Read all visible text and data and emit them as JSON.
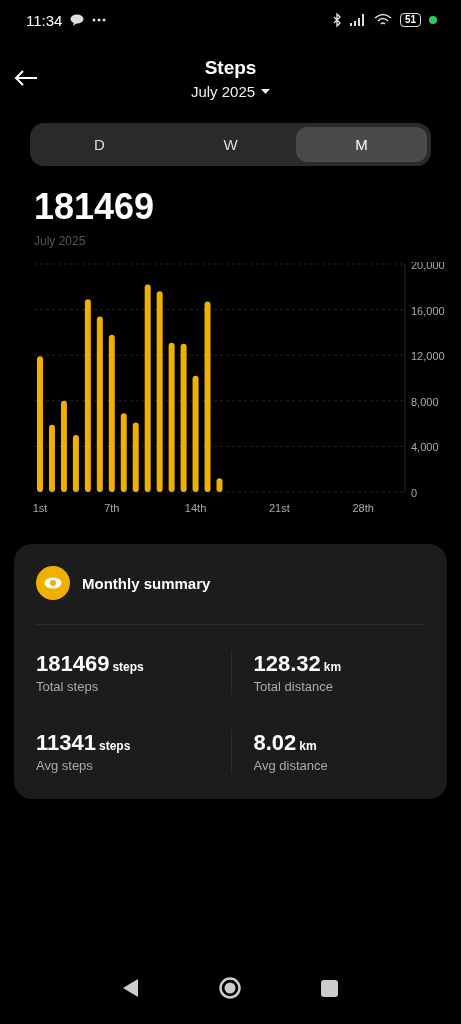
{
  "status_bar": {
    "time": "11:34",
    "battery": "51"
  },
  "header": {
    "title": "Steps",
    "period": "July 2025"
  },
  "tabs": [
    {
      "label": "D",
      "selected": false
    },
    {
      "label": "W",
      "selected": false
    },
    {
      "label": "M",
      "selected": true
    }
  ],
  "total": {
    "value": "181469",
    "caption": "July 2025"
  },
  "chart_data": {
    "type": "bar",
    "grid": true,
    "x": [
      1,
      2,
      3,
      4,
      5,
      6,
      7,
      8,
      9,
      10,
      11,
      12,
      13,
      14,
      15,
      16
    ],
    "xlim": [
      0.5,
      31.5
    ],
    "series": [
      {
        "color": "#f0b000",
        "values": [
          11900,
          5900,
          8000,
          5000,
          16900,
          15400,
          13800,
          6900,
          6100,
          18200,
          17600,
          13100,
          13000,
          10200,
          16700,
          1200
        ]
      }
    ],
    "xticks": [
      {
        "value": 1,
        "label": "1st"
      },
      {
        "value": 7,
        "label": "7th"
      },
      {
        "value": 14,
        "label": "14th"
      },
      {
        "value": 21,
        "label": "21st"
      },
      {
        "value": 28,
        "label": "28th"
      }
    ],
    "yticks": [
      {
        "value": 0,
        "label": "0"
      },
      {
        "value": 4000,
        "label": "4,000"
      },
      {
        "value": 8000,
        "label": "8,000"
      },
      {
        "value": 12000,
        "label": "12,000"
      },
      {
        "value": 16000,
        "label": "16,000"
      },
      {
        "value": 20000,
        "label": "20,000"
      }
    ],
    "ylim": [
      0,
      20000
    ]
  },
  "summary": {
    "title": "Monthly summary",
    "stats": [
      {
        "value": "181469",
        "unit": "steps",
        "label": "Total steps"
      },
      {
        "value": "128.32",
        "unit": "km",
        "label": "Total distance"
      },
      {
        "value": "11341",
        "unit": "steps",
        "label": "Avg steps"
      },
      {
        "value": "8.02",
        "unit": "km",
        "label": "Avg distance"
      }
    ]
  }
}
